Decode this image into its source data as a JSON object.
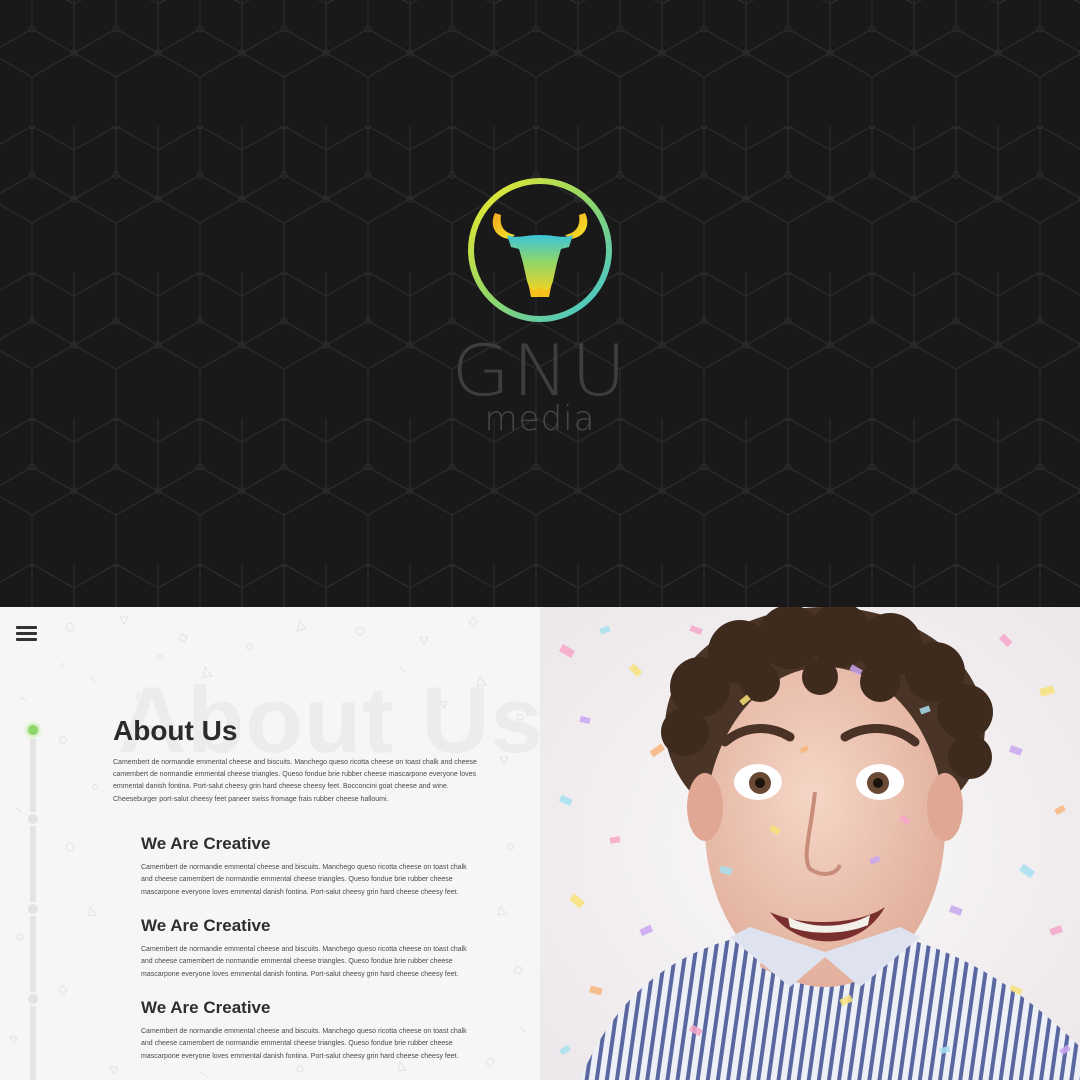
{
  "brand": {
    "name": "GNU",
    "sub": "media",
    "logo_icon": "bull-head-icon",
    "gradient": [
      "#f2ea27",
      "#8ed66a",
      "#3cc4d9"
    ]
  },
  "nav": {
    "menu_icon": "hamburger-menu-icon"
  },
  "about": {
    "ghost_title": "About Us",
    "title": "About Us",
    "text": "Camembert de normandie emmental cheese and biscuits. Manchego queso ricotta cheese on toast chalk and cheese camembert de normandie emmental cheese triangles. Queso fondue brie rubber cheese mascarpone everyone loves emmental danish fontina. Port-salut cheesy grin hard cheese cheesy feet. Bocconcini goat cheese and wine. Cheeseburger port-salut cheesy feet paneer swiss fromage frais rubber cheese halloumi.",
    "features": [
      {
        "title": "We Are Creative",
        "text": "Camembert de normandie emmental cheese and biscuits. Manchego queso ricotta cheese on toast chalk and cheese camembert de normandie emmental cheese triangles. Queso fondue brie rubber cheese mascarpone everyone loves emmental danish fontina. Port-salut cheesy grin hard cheese cheesy feet."
      },
      {
        "title": "We Are Creative",
        "text": "Camembert de normandie emmental cheese and biscuits. Manchego queso ricotta cheese on toast chalk and cheese camembert de normandie emmental cheese triangles. Queso fondue brie rubber cheese mascarpone everyone loves emmental danish fontina. Port-salut cheesy grin hard cheese cheesy feet."
      },
      {
        "title": "We Are Creative",
        "text": "Camembert de normandie emmental cheese and biscuits. Manchego queso ricotta cheese on toast chalk and cheese camembert de normandie emmental cheese triangles. Queso fondue brie rubber cheese mascarpone everyone loves emmental danish fontina. Port-salut cheesy grin hard cheese cheesy feet."
      }
    ]
  },
  "colors": {
    "hero_bg": "#19191a",
    "accent_green": "#8ed66a",
    "section_bg": "#f6f6f6"
  }
}
